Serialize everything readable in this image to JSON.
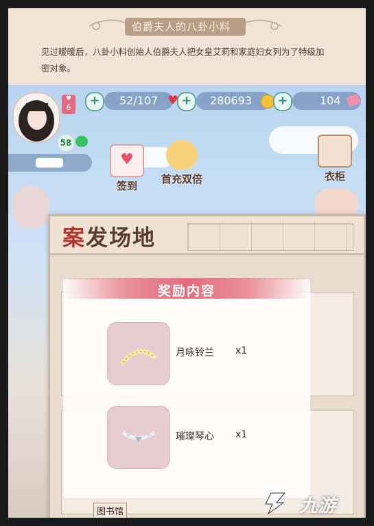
{
  "story": {
    "title": "伯爵夫人的八卦小料",
    "text": "见过暧暧后，八卦小料创始人伯爵夫人把女皇艾莉和家庭妇女列为了特级加密对象。"
  },
  "status": {
    "level": "6",
    "vip": "58",
    "stamina": "52/107",
    "gold": "280693",
    "diamonds": "104",
    "plus_symbol": "+"
  },
  "scene_buttons": {
    "sign_in": "签到",
    "first_recharge": "首充双倍",
    "wardrobe": "衣柜"
  },
  "case_panel": {
    "title_first": "案",
    "title_rest": "发场地",
    "location_tag": "图书馆"
  },
  "reward_modal": {
    "title": "奖励内容",
    "items": [
      {
        "name": "月咏铃兰",
        "qty": "x1"
      },
      {
        "name": "璀璨琴心",
        "qty": "x1"
      }
    ]
  },
  "watermark": {
    "text": "九游"
  },
  "colors": {
    "accent_pink": "#e46b7d",
    "case_red": "#b0382e"
  }
}
